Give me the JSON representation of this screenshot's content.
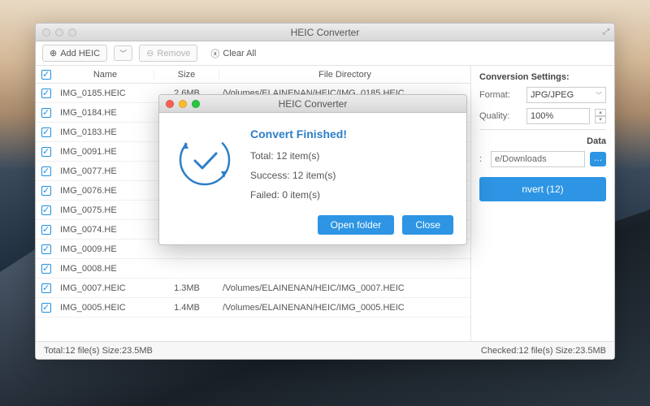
{
  "mainWindow": {
    "title": "HEIC Converter",
    "toolbar": {
      "addLabel": "Add HEIC",
      "removeLabel": "Remove",
      "clearLabel": "Clear All"
    },
    "columns": {
      "name": "Name",
      "size": "Size",
      "dir": "File Directory"
    },
    "rows": [
      {
        "name": "IMG_0185.HEIC",
        "size": "2.6MB",
        "dir": "/Volumes/ELAINENAN/HEIC/IMG_0185.HEIC"
      },
      {
        "name": "IMG_0184.HE",
        "size": "",
        "dir": ""
      },
      {
        "name": "IMG_0183.HE",
        "size": "",
        "dir": ""
      },
      {
        "name": "IMG_0091.HE",
        "size": "",
        "dir": ""
      },
      {
        "name": "IMG_0077.HE",
        "size": "",
        "dir": ""
      },
      {
        "name": "IMG_0076.HE",
        "size": "",
        "dir": ""
      },
      {
        "name": "IMG_0075.HE",
        "size": "",
        "dir": ""
      },
      {
        "name": "IMG_0074.HE",
        "size": "",
        "dir": ""
      },
      {
        "name": "IMG_0009.HE",
        "size": "",
        "dir": ""
      },
      {
        "name": "IMG_0008.HE",
        "size": "",
        "dir": ""
      },
      {
        "name": "IMG_0007.HEIC",
        "size": "1.3MB",
        "dir": "/Volumes/ELAINENAN/HEIC/IMG_0007.HEIC"
      },
      {
        "name": "IMG_0005.HEIC",
        "size": "1.4MB",
        "dir": "/Volumes/ELAINENAN/HEIC/IMG_0005.HEIC"
      }
    ],
    "status": {
      "left": "Total:12 file(s) Size:23.5MB",
      "right": "Checked:12 file(s) Size:23.5MB"
    }
  },
  "settings": {
    "heading": "Conversion Settings:",
    "formatLabel": "Format:",
    "formatValue": "JPG/JPEG",
    "qualityLabel": "Quality:",
    "qualityValue": "100%",
    "dataHeading": "Data",
    "outputPath": "e/Downloads",
    "convertLabel": "nvert (12)"
  },
  "dialog": {
    "title": "HEIC Converter",
    "heading": "Convert Finished!",
    "lines": {
      "total": "Total: 12 item(s)",
      "success": "Success: 12 item(s)",
      "failed": "Failed: 0 item(s)"
    },
    "openFolder": "Open folder",
    "close": "Close"
  }
}
